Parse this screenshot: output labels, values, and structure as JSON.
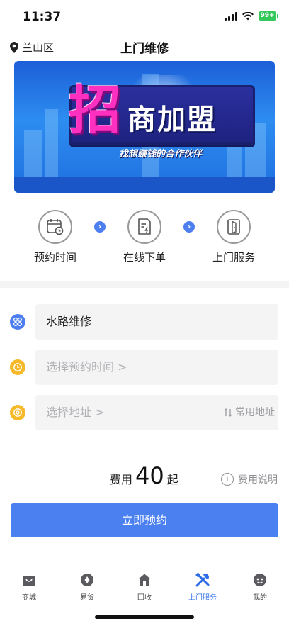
{
  "status_bar": {
    "time": "11:37",
    "battery": "99+"
  },
  "header": {
    "location": "兰山区",
    "title": "上门维修"
  },
  "banner": {
    "big_char": "招",
    "main_text": "商加盟",
    "sub_text": "找想赚钱的合作伙伴"
  },
  "steps": [
    {
      "label": "预约时间",
      "icon": "calendar-clock-icon"
    },
    {
      "label": "在线下单",
      "icon": "order-form-icon"
    },
    {
      "label": "上门服务",
      "icon": "door-icon"
    }
  ],
  "form": {
    "service": {
      "value": "水路维修",
      "icon_color": "#4d7ff0"
    },
    "time": {
      "placeholder": "选择预约时间 >",
      "icon_color": "#f5b92a"
    },
    "address": {
      "placeholder": "选择地址 >",
      "common_label": "常用地址",
      "icon_color": "#f5b92a"
    }
  },
  "fee": {
    "label": "费用",
    "value": "40",
    "unit": "起",
    "info_label": "费用说明"
  },
  "book_button": "立即预约",
  "tabbar": [
    {
      "label": "商城",
      "icon": "shop-bag-icon"
    },
    {
      "label": "易货",
      "icon": "barter-icon"
    },
    {
      "label": "回收",
      "icon": "home-recycle-icon"
    },
    {
      "label": "上门服务",
      "icon": "tools-icon",
      "active": true
    },
    {
      "label": "我的",
      "icon": "profile-face-icon"
    }
  ],
  "colors": {
    "accent": "#4b80f0",
    "active_tab": "#2e6de6",
    "form_bg": "#f4f4f5"
  }
}
